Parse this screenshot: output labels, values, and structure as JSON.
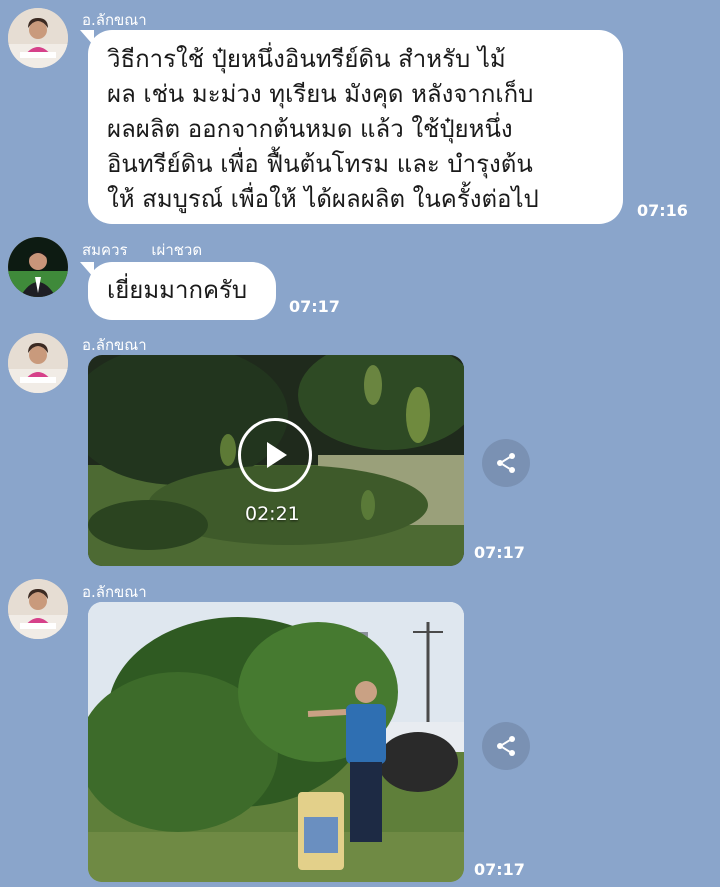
{
  "theme": {
    "background": "#8aa5cb",
    "bubble": "#ffffff",
    "meta_text": "#ffffff"
  },
  "messages": [
    {
      "sender": "อ.ลักขณา",
      "type": "text",
      "text": "วิธีการใช้ ปุ๋ยหนึ่งอินทรีย์ดิน สำหรับ ไม้\nผล เช่น มะม่วง ทุเรียน มังคุด หลังจากเก็บ\nผลผลิต ออกจากต้นหมด แล้ว ใช้ปุ๋ยหนึ่ง\nอินทรีย์ดิน เพื่อ ฟื้นต้นโทรม และ บำรุงต้น\nให้ สมบูรณ์ เพื่อให้ ได้ผลผลิต ในครั้งต่อไป",
      "time": "07:16"
    },
    {
      "sender": "สมควร     เผ่าชวด",
      "type": "text",
      "text": "เยี่ยมมากครับ",
      "time": "07:17"
    },
    {
      "sender": "อ.ลักขณา",
      "type": "video",
      "duration": "02:21",
      "icon": "play-icon",
      "time": "07:17"
    },
    {
      "sender": "อ.ลักขณา",
      "type": "image",
      "time": "07:17"
    }
  ],
  "share_icon": "share-icon"
}
